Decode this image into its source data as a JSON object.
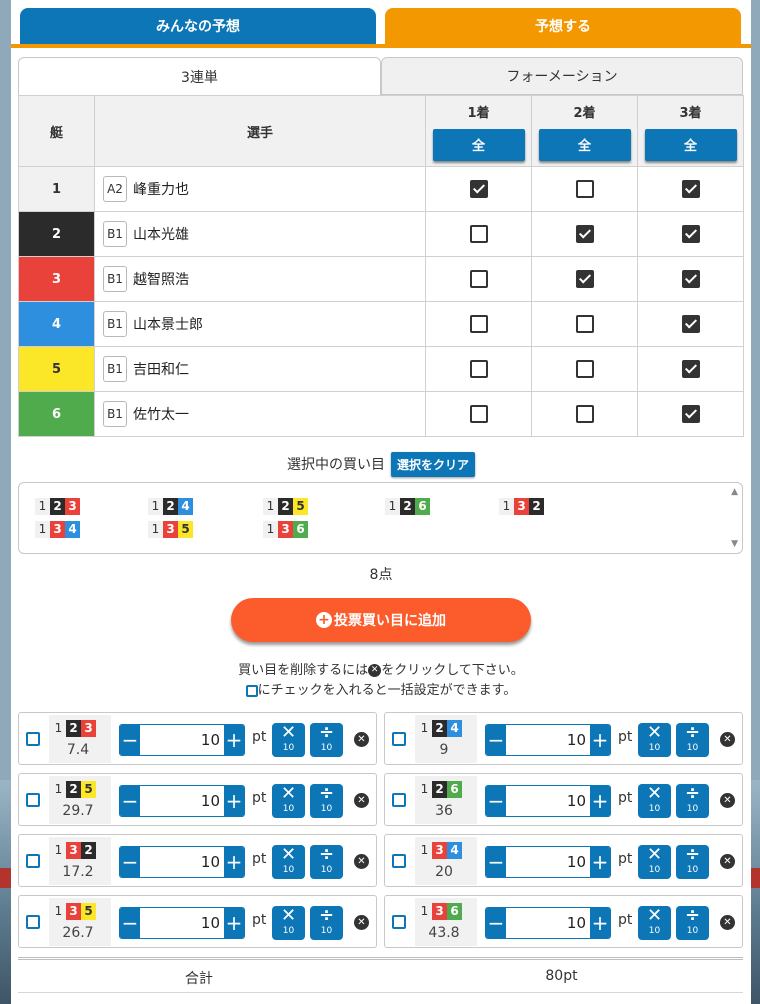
{
  "top_tabs": {
    "everyone_label": "みんなの予想",
    "predict_label": "予想する"
  },
  "sub_tabs": {
    "trifecta_label": "3連単",
    "formation_label": "フォーメーション"
  },
  "table": {
    "boat_header": "艇",
    "racer_header": "選手",
    "pos1_header": "1着",
    "pos2_header": "2着",
    "pos3_header": "3着",
    "all_label": "全",
    "rows": [
      {
        "boat": "1",
        "grade": "A2",
        "name": "峰重力也",
        "first": true,
        "second": false,
        "third": true
      },
      {
        "boat": "2",
        "grade": "B1",
        "name": "山本光雄",
        "first": false,
        "second": true,
        "third": true
      },
      {
        "boat": "3",
        "grade": "B1",
        "name": "越智照浩",
        "first": false,
        "second": true,
        "third": true
      },
      {
        "boat": "4",
        "grade": "B1",
        "name": "山本景士郎",
        "first": false,
        "second": false,
        "third": true
      },
      {
        "boat": "5",
        "grade": "B1",
        "name": "吉田和仁",
        "first": false,
        "second": false,
        "third": true
      },
      {
        "boat": "6",
        "grade": "B1",
        "name": "佐竹太一",
        "first": false,
        "second": false,
        "third": true
      }
    ]
  },
  "selection": {
    "label": "選択中の買い目",
    "clear_label": "選択をクリア",
    "combos": [
      [
        "1",
        "2",
        "3"
      ],
      [
        "1",
        "2",
        "4"
      ],
      [
        "1",
        "2",
        "5"
      ],
      [
        "1",
        "2",
        "6"
      ],
      [
        "1",
        "3",
        "2"
      ],
      [
        "1",
        "3",
        "4"
      ],
      [
        "1",
        "3",
        "5"
      ],
      [
        "1",
        "3",
        "6"
      ]
    ],
    "count_label": "8点"
  },
  "add_button": {
    "icon": "plus-circle-icon",
    "label": "投票買い目に追加"
  },
  "notes": {
    "delete_pre": "買い目を削除するには",
    "delete_post": "をクリックして下さい。",
    "bulk_text": "にチェックを入れると一括設定ができます。"
  },
  "bets": [
    {
      "combo": [
        "1",
        "2",
        "3"
      ],
      "odds": "7.4",
      "amount": "10"
    },
    {
      "combo": [
        "1",
        "2",
        "4"
      ],
      "odds": "9",
      "amount": "10"
    },
    {
      "combo": [
        "1",
        "2",
        "5"
      ],
      "odds": "29.7",
      "amount": "10"
    },
    {
      "combo": [
        "1",
        "2",
        "6"
      ],
      "odds": "36",
      "amount": "10"
    },
    {
      "combo": [
        "1",
        "3",
        "2"
      ],
      "odds": "17.2",
      "amount": "10"
    },
    {
      "combo": [
        "1",
        "3",
        "4"
      ],
      "odds": "20",
      "amount": "10"
    },
    {
      "combo": [
        "1",
        "3",
        "5"
      ],
      "odds": "26.7",
      "amount": "10"
    },
    {
      "combo": [
        "1",
        "3",
        "6"
      ],
      "odds": "43.8",
      "amount": "10"
    }
  ],
  "bet_controls": {
    "unit": "pt",
    "multiply_symbol": "✕",
    "multiply_value": "10",
    "divide_symbol": "÷",
    "divide_value": "10",
    "minus": "−",
    "plus": "+",
    "delete_icon": "close-circle-icon"
  },
  "total": {
    "label": "合計",
    "value": "80pt"
  },
  "colors": {
    "accent_blue": "#0c76b6",
    "accent_orange": "#f39800",
    "add_button": "#fc5c2c",
    "boat1": "#f1f1f1",
    "boat2": "#2b2b2b",
    "boat3": "#e9423a",
    "boat4": "#2e8fde",
    "boat5": "#fbe628",
    "boat6": "#50ab4d"
  }
}
